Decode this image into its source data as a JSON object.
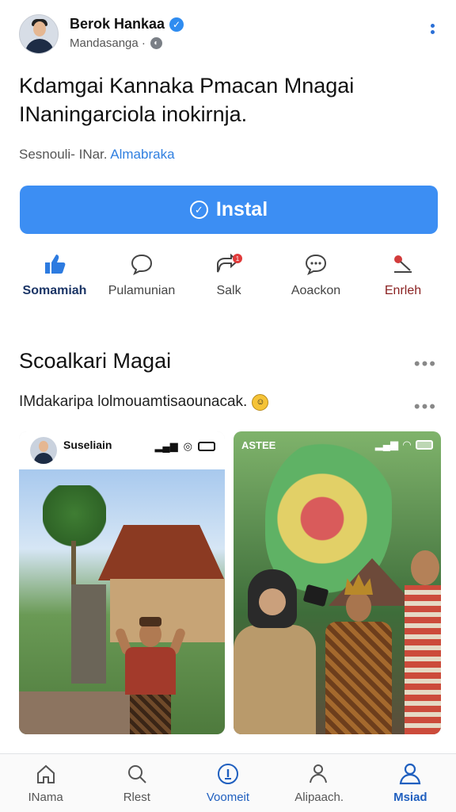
{
  "post": {
    "author_name": "Berok Hankaa",
    "author_sub": "Mandasanga ·",
    "headline": "Kdamgai Kannaka Pmacan Mnagai INaningarciola inokirnja.",
    "meta_prefix": "Sesnouli- INar. ",
    "meta_link": "Almabraka",
    "install_label": "Instal"
  },
  "actions": [
    {
      "label": "Somamiah",
      "icon": "thumbs-up-icon"
    },
    {
      "label": "Pulamunian",
      "icon": "comment-icon"
    },
    {
      "label": "Salk",
      "icon": "share-icon"
    },
    {
      "label": "Aoackon",
      "icon": "chat-icon"
    },
    {
      "label": "Enrleh",
      "icon": "pin-icon"
    }
  ],
  "section": {
    "title": "Scoalkari Magai",
    "caption": "IMdakaripa lolmouamtisaounacak."
  },
  "cards": [
    {
      "user": "Suseliain",
      "kind": "photo-post"
    },
    {
      "kind": "photo-post",
      "badge": "ASTEE"
    }
  ],
  "tabbar": {
    "items": [
      {
        "label": "INama",
        "icon": "home-icon"
      },
      {
        "label": "Rlest",
        "icon": "search-icon"
      },
      {
        "label": "Voomeit",
        "icon": "info-icon"
      },
      {
        "label": "Alipaach.",
        "icon": "people-icon"
      },
      {
        "label": "Msiad",
        "icon": "profile-icon"
      }
    ],
    "active_index": 4
  },
  "colors": {
    "accent": "#3c8ef3",
    "link": "#2f7fe0",
    "active_tab": "#1f5fbf"
  }
}
